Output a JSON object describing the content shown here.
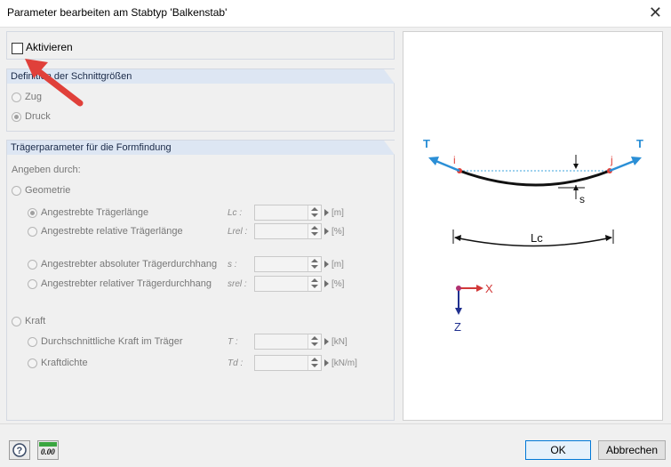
{
  "window": {
    "title": "Parameter bearbeiten am Stabtyp   'Balkenstab'",
    "close_glyph": "✕"
  },
  "activate": {
    "label": "Aktivieren",
    "checked": false
  },
  "definition": {
    "header": "Definition der Schnittgrößen",
    "options": [
      {
        "label": "Zug",
        "selected": false
      },
      {
        "label": "Druck",
        "selected": true
      }
    ]
  },
  "girder": {
    "header": "Trägerparameter für die Formfindung",
    "specify_label": "Angeben durch:",
    "geometry": {
      "label": "Geometrie",
      "selected": false
    },
    "geometry_items": [
      {
        "label": "Angestrebte Trägerlänge",
        "symbol": "Lc :",
        "unit": "[m]",
        "selected": true
      },
      {
        "label": "Angestrebte relative Trägerlänge",
        "symbol": "Lrel :",
        "unit": "[%]",
        "selected": false
      },
      {
        "label": "Angestrebter absoluter Trägerdurchhang",
        "symbol": "s :",
        "unit": "[m]",
        "selected": false
      },
      {
        "label": "Angestrebter relativer Trägerdurchhang",
        "symbol": "srel :",
        "unit": "[%]",
        "selected": false
      }
    ],
    "force": {
      "label": "Kraft",
      "selected": false
    },
    "force_items": [
      {
        "label": "Durchschnittliche Kraft im Träger",
        "symbol": "T :",
        "unit": "[kN]",
        "selected": false
      },
      {
        "label": "Kraftdichte",
        "symbol": "Td :",
        "unit": "[kN/m]",
        "selected": false
      }
    ]
  },
  "diagram": {
    "left_force": "T",
    "right_force": "T",
    "node_i": "i",
    "node_j": "j",
    "sag": "s",
    "length": "Lc",
    "axis_x": "X",
    "axis_z": "Z"
  },
  "buttons": {
    "ok": "OK",
    "cancel": "Abbrechen"
  },
  "toolbar": {
    "units_label": "0.00"
  },
  "colors": {
    "accent": "#0078d7",
    "annotation": "#e0403a",
    "force": "#2b8fd6",
    "axis_x": "#d23838",
    "axis_z": "#20308f"
  },
  "icons": [
    "help-icon",
    "units-icon",
    "close-icon",
    "red-pointer-arrow-icon"
  ]
}
